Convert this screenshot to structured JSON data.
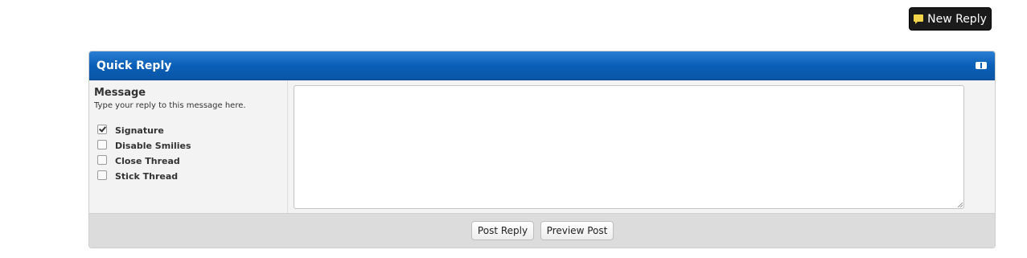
{
  "new_reply": {
    "label": "New Reply",
    "icon": "speech-bubble-icon"
  },
  "panel": {
    "title": "Quick Reply",
    "collapse_icon": "collapse-icon",
    "message_title": "Message",
    "message_hint": "Type your reply to this message here.",
    "textarea_value": "",
    "options": [
      {
        "label": "Signature",
        "checked": true
      },
      {
        "label": "Disable Smilies",
        "checked": false
      },
      {
        "label": "Close Thread",
        "checked": false
      },
      {
        "label": "Stick Thread",
        "checked": false
      }
    ],
    "post_label": "Post Reply",
    "preview_label": "Preview Post"
  },
  "colors": {
    "header": "#0b5fb7",
    "new_reply_bg": "#1b1b1b",
    "footer": "#dcdcdc"
  }
}
